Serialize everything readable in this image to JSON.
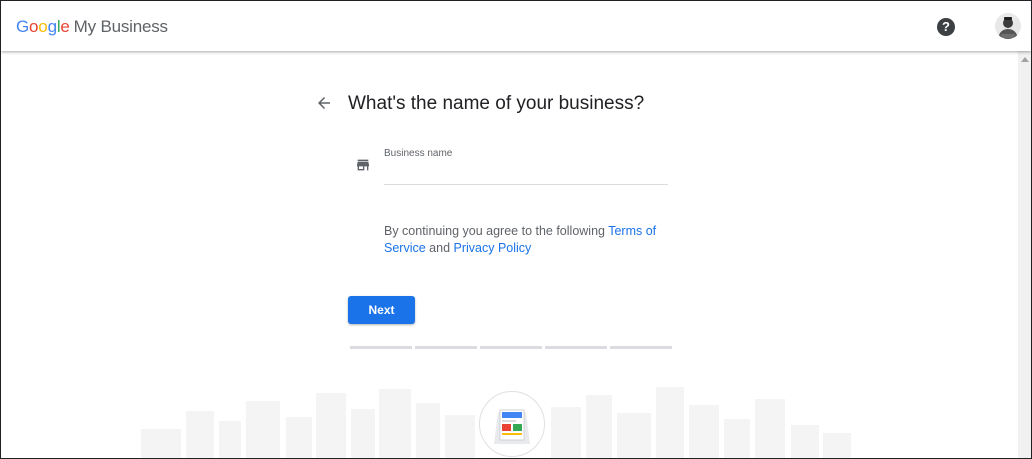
{
  "header": {
    "logo_letters": [
      "G",
      "o",
      "o",
      "g",
      "l",
      "e"
    ],
    "product_name": "My Business",
    "help_glyph": "?",
    "help_icon": "help-circle-icon",
    "avatar_icon": "account-avatar"
  },
  "main": {
    "back_icon": "arrow-back-icon",
    "heading": "What's the name of your business?",
    "field_icon": "storefront-icon",
    "field_label": "Business name",
    "field_value": "",
    "terms_prefix": "By continuing you agree to the following",
    "terms_link": "Terms of Service",
    "terms_middle": "and",
    "privacy_link": "Privacy Policy",
    "next_label": "Next",
    "progress_steps": 5,
    "current_step": 0
  },
  "colors": {
    "primary": "#1a73e8",
    "google_blue": "#4285F4",
    "google_red": "#EA4335",
    "google_yellow": "#FBBC05",
    "google_green": "#34A853"
  }
}
